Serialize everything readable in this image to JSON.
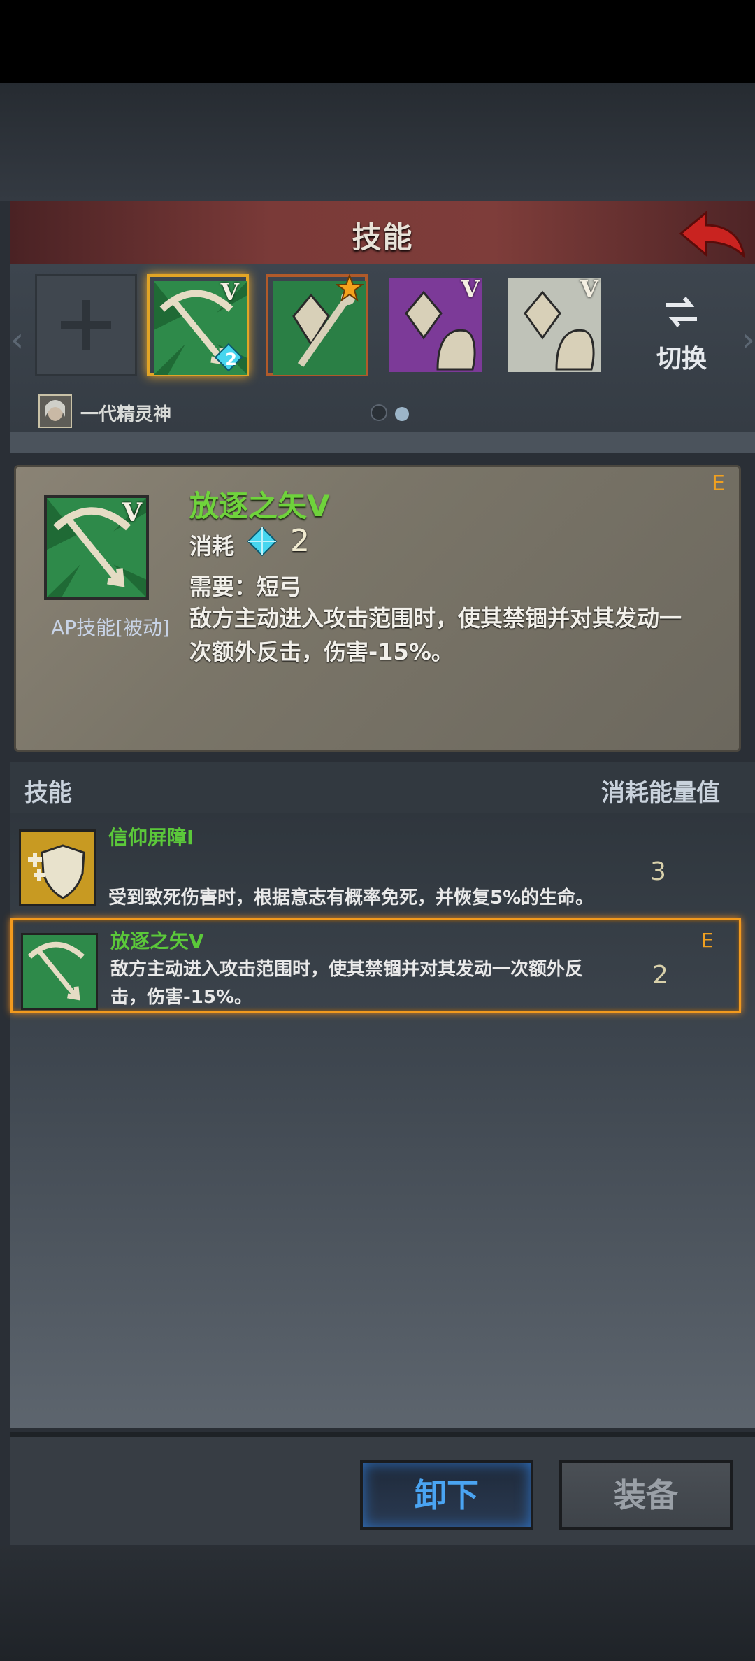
{
  "header": {
    "title": "技能"
  },
  "slots": [
    {
      "name": "slot-empty",
      "level": ""
    },
    {
      "name": "exile-arrow",
      "level": "V",
      "badge": "2",
      "selected": true
    },
    {
      "name": "crystal-staff",
      "level": "",
      "star": true
    },
    {
      "name": "crystal-purple",
      "level": "V"
    },
    {
      "name": "crystal-white",
      "level": "V"
    }
  ],
  "switch_label": "切换",
  "character": {
    "name": "一代精灵神"
  },
  "pager": {
    "current": 2,
    "total": 2
  },
  "detail": {
    "name": "放逐之矢V",
    "grade": "E",
    "cost_label": "消耗",
    "cost_value": "2",
    "requirement": "需要：短弓",
    "description": "敌方主动进入攻击范围时，使其禁锢并对其发动一次额外反击，伤害-15%。",
    "type": "AP技能[被动]"
  },
  "list_header": {
    "left": "技能",
    "right": "消耗能量值"
  },
  "skills": [
    {
      "name": "信仰屏障I",
      "description": "受到致死伤害时，根据意志有概率免死，并恢复5%的生命。",
      "cost": "3",
      "grade": ""
    },
    {
      "name": "放逐之矢V",
      "description": "敌方主动进入攻击范围时，使其禁锢并对其发动一次额外反击，伤害-15%。",
      "cost": "2",
      "grade": "E"
    }
  ],
  "buttons": {
    "unequip": "卸下",
    "equip": "装备"
  },
  "colors": {
    "accent_orange": "#e2a526",
    "name_green": "#6fd33c",
    "unequip_blue": "#4aa4f2"
  }
}
